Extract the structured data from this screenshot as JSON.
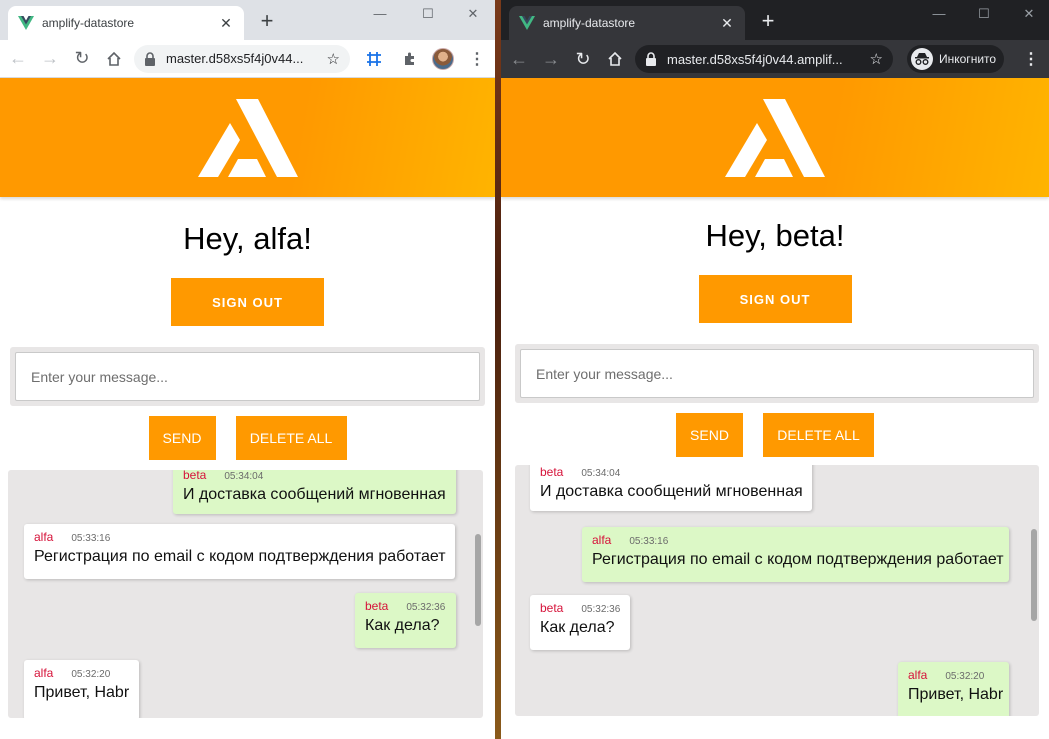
{
  "windows": [
    {
      "id": "left",
      "tab": {
        "title": "amplify-datastore",
        "close": "✕"
      },
      "new_tab": "+",
      "controls": {
        "minimize": "—",
        "maximize": "☐",
        "close": "✕"
      },
      "url": "master.d58xs5f4j0v44...",
      "greeting": "Hey, alfa!",
      "sign_out": "SIGN OUT",
      "placeholder": "Enter your message...",
      "send": "SEND",
      "delete_all": "DELETE ALL",
      "messages": [
        {
          "author": "beta",
          "time": "05:34:04",
          "text": "И доставка сообщений мгновенная",
          "own": false
        },
        {
          "author": "alfa",
          "time": "05:33:16",
          "text": "Регистрация по email с кодом подтверждения работает",
          "own": true
        },
        {
          "author": "beta",
          "time": "05:32:36",
          "text": "Как дела?",
          "own": false
        },
        {
          "author": "alfa",
          "time": "05:32:20",
          "text": "Привет, Habr",
          "own": true
        }
      ]
    },
    {
      "id": "right",
      "tab": {
        "title": "amplify-datastore",
        "close": "✕"
      },
      "new_tab": "+",
      "controls": {
        "minimize": "—",
        "maximize": "☐",
        "close": "✕"
      },
      "url": "master.d58xs5f4j0v44.amplif...",
      "incognito_label": "Инкогнито",
      "greeting": "Hey, beta!",
      "sign_out": "SIGN OUT",
      "placeholder": "Enter your message...",
      "send": "SEND",
      "delete_all": "DELETE ALL",
      "messages": [
        {
          "author": "beta",
          "time": "05:34:04",
          "text": "И доставка сообщений мгновенная",
          "own": true
        },
        {
          "author": "alfa",
          "time": "05:33:16",
          "text": "Регистрация по email с кодом подтверждения работает",
          "own": false
        },
        {
          "author": "beta",
          "time": "05:32:36",
          "text": "Как дела?",
          "own": true
        },
        {
          "author": "alfa",
          "time": "05:32:20",
          "text": "Привет, Habr",
          "own": false
        }
      ]
    }
  ],
  "colors": {
    "brand": "#ff9900",
    "own_bubble": "#dcf8c6",
    "other_bubble": "#ffffff",
    "author": "#d6133a",
    "feed_bg": "#e8e6e6"
  },
  "icons": {
    "favicon": "vue-logo-icon",
    "banner": "amplify-logo-icon"
  }
}
